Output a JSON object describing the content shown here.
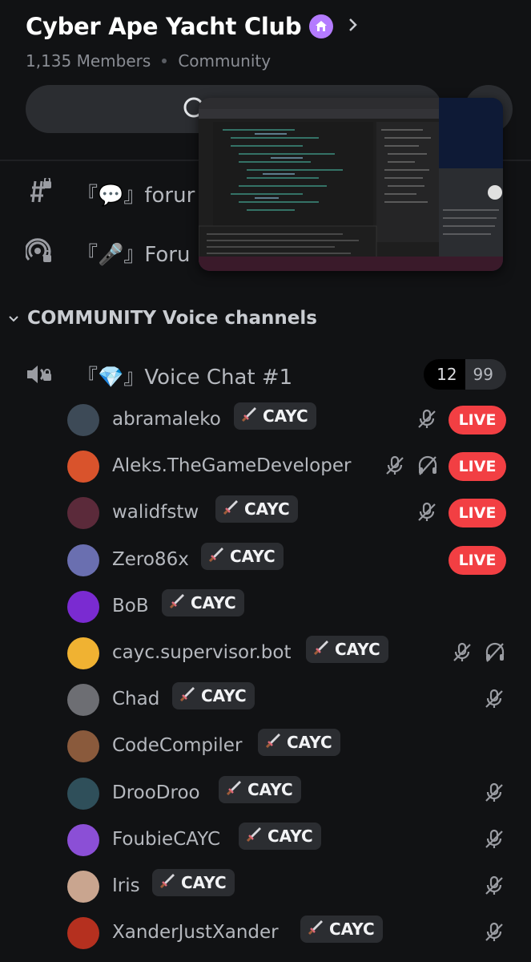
{
  "server": {
    "name": "Cyber Ape Yacht Club",
    "members": "1,135 Members",
    "type": "Community"
  },
  "channels": [
    {
      "label": "『💬』forur",
      "icon": "locked-text-channel-icon"
    },
    {
      "label": "『🎤』Foru",
      "icon": "locked-forum-channel-icon"
    }
  ],
  "category": {
    "label": "COMMUNITY Voice channels"
  },
  "voice_channel": {
    "name": "『💎』Voice Chat #1",
    "count": "12",
    "limit": "99"
  },
  "members": [
    {
      "name": "abramaleko",
      "tag": "CAYC",
      "live": "LIVE",
      "muted": true,
      "deafened": false,
      "avatar_color": "#3d4a57"
    },
    {
      "name": "Aleks.TheGameDeveloper",
      "tag": "",
      "live": "LIVE",
      "muted": true,
      "deafened": true,
      "avatar_color": "#d9532c"
    },
    {
      "name": "walidfstw",
      "tag": "CAYC",
      "live": "LIVE",
      "muted": true,
      "deafened": false,
      "avatar_color": "#5b2a3a"
    },
    {
      "name": "Zero86x",
      "tag": "CAYC",
      "live": "LIVE",
      "muted": false,
      "deafened": false,
      "avatar_color": "#6a6fb0"
    },
    {
      "name": "BoB",
      "tag": "CAYC",
      "live": "",
      "muted": false,
      "deafened": false,
      "avatar_color": "#7a2bd1"
    },
    {
      "name": "cayc.supervisor.bot",
      "tag": "CAYC",
      "live": "",
      "muted": true,
      "deafened": true,
      "avatar_color": "#f0b232"
    },
    {
      "name": "Chad",
      "tag": "CAYC",
      "live": "",
      "muted": true,
      "deafened": false,
      "avatar_color": "#6d6e73"
    },
    {
      "name": "CodeCompiler",
      "tag": "CAYC",
      "live": "",
      "muted": false,
      "deafened": false,
      "avatar_color": "#8a5a3c"
    },
    {
      "name": "DrooDroo",
      "tag": "CAYC",
      "live": "",
      "muted": true,
      "deafened": false,
      "avatar_color": "#2f4f5a"
    },
    {
      "name": "FoubieCAYC",
      "tag": "CAYC",
      "live": "",
      "muted": true,
      "deafened": false,
      "avatar_color": "#8b4fd6"
    },
    {
      "name": "Iris",
      "tag": "CAYC",
      "live": "",
      "muted": true,
      "deafened": false,
      "avatar_color": "#c9a58f"
    },
    {
      "name": "XanderJustXander",
      "tag": "CAYC",
      "live": "",
      "muted": true,
      "deafened": false,
      "avatar_color": "#b5301f"
    }
  ],
  "colors": {
    "background": "#111214",
    "live_badge": "#f23f43",
    "boost_badge": "#b47bff",
    "tag_background": "#2b2d31"
  }
}
